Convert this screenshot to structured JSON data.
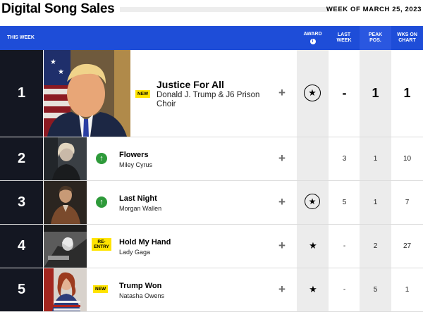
{
  "page_title": "Digital Song Sales",
  "week_label": "WEEK OF MARCH 25, 2023",
  "header": {
    "this_week": "THIS WEEK",
    "award": "AWARD",
    "award_info": "i",
    "last_week": "LAST WEEK",
    "peak_pos": "PEAK POS.",
    "wks_on_chart": "WKS ON CHART"
  },
  "rows": [
    {
      "rank": "1",
      "badge": "NEW",
      "song": "Justice For All",
      "artist": "Donald J. Trump & J6 Prison Choir",
      "award": "star-circle-icon",
      "last_week": "-",
      "peak": "1",
      "weeks": "1"
    },
    {
      "rank": "2",
      "badge": "",
      "trend": "up-arrow-icon",
      "song": "Flowers",
      "artist": "Miley Cyrus",
      "award": "",
      "last_week": "3",
      "peak": "1",
      "weeks": "10"
    },
    {
      "rank": "3",
      "badge": "",
      "trend": "up-arrow-icon",
      "song": "Last Night",
      "artist": "Morgan Wallen",
      "award": "star-circle-icon",
      "last_week": "5",
      "peak": "1",
      "weeks": "7"
    },
    {
      "rank": "4",
      "badge": "RE- ENTRY",
      "song": "Hold My Hand",
      "artist": "Lady Gaga",
      "award": "star-icon",
      "last_week": "-",
      "peak": "2",
      "weeks": "27"
    },
    {
      "rank": "5",
      "badge": "NEW",
      "song": "Trump Won",
      "artist": "Natasha Owens",
      "award": "star-icon",
      "last_week": "-",
      "peak": "5",
      "weeks": "1"
    }
  ],
  "icons": {
    "plus": "+",
    "arrow_up": "↑",
    "star": "★"
  },
  "colors": {
    "header_blue": "#1e4dd8",
    "rank_bg": "#141722",
    "badge_yellow": "#ffe400",
    "trend_green": "#2e9a3a"
  }
}
